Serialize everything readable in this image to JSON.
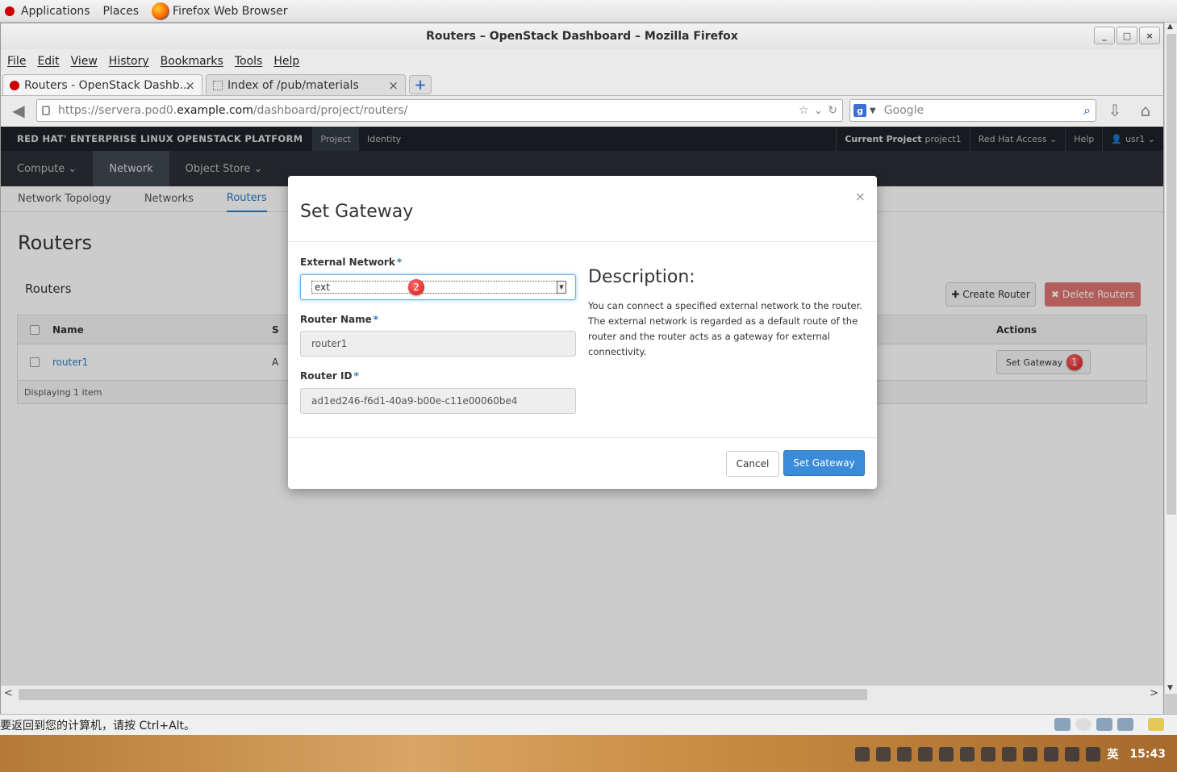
{
  "gnome_panel": {
    "applications": "Applications",
    "places": "Places",
    "active_app": "Firefox Web Browser"
  },
  "window": {
    "title": "Routers – OpenStack Dashboard – Mozilla Firefox",
    "minimize": "_",
    "maximize": "□",
    "close": "×"
  },
  "menubar": [
    "File",
    "Edit",
    "View",
    "History",
    "Bookmarks",
    "Tools",
    "Help"
  ],
  "tabs": [
    {
      "label": "Routers - OpenStack Dashb...",
      "close": "×"
    },
    {
      "label": "Index of /pub/materials",
      "close": "×"
    }
  ],
  "new_tab": "+",
  "navbar": {
    "url_prefix": "https://servera.pod0.",
    "url_domain": "example.com",
    "url_path": "/dashboard/project/routers/",
    "search_placeholder": "Google",
    "search_engine_icon": "g"
  },
  "openstack": {
    "brand": "RED HAT' ENTERPRISE LINUX OPENSTACK PLATFORM",
    "top_nav": [
      "Project",
      "Identity"
    ],
    "current_project_label": "Current Project",
    "current_project_value": "project1 ",
    "red_hat_access": "Red Hat Access ⌄",
    "help": "Help",
    "user": "usr1 ⌄",
    "sub_nav": [
      "Compute  ⌄",
      "Network",
      "Object Store  ⌄"
    ],
    "panel_tabs": [
      "Network Topology",
      "Networks",
      "Routers"
    ],
    "page_title": "Routers",
    "table_title": "Routers",
    "create_router": "Create Router",
    "delete_routers": "Delete Routers",
    "table": {
      "columns": [
        "Name",
        "S",
        "Actions"
      ],
      "rows": [
        {
          "name": "router1",
          "status_initial": "A",
          "action": "Set Gateway"
        }
      ],
      "footer": "Displaying 1 item"
    }
  },
  "modal": {
    "title": "Set Gateway",
    "close": "×",
    "external_network_label": "External Network",
    "external_network_value": "ext",
    "router_name_label": "Router Name",
    "router_name_value": "router1",
    "router_id_label": "Router ID",
    "router_id_value": "ad1ed246-f6d1-40a9-b00e-c11e00060be4",
    "required_mark": "*",
    "description_title": "Description:",
    "description_text": "You can connect a specified external network to the router. The external network is regarded as a default route of the router and the router acts as a gateway for external connectivity.",
    "cancel": "Cancel",
    "submit": "Set Gateway"
  },
  "markers": {
    "one": "1",
    "two": "2"
  },
  "vm_status": "要返回到您的计算机，请按 Ctrl+Alt。",
  "taskbar": {
    "ime": "英",
    "clock": "15:43"
  }
}
